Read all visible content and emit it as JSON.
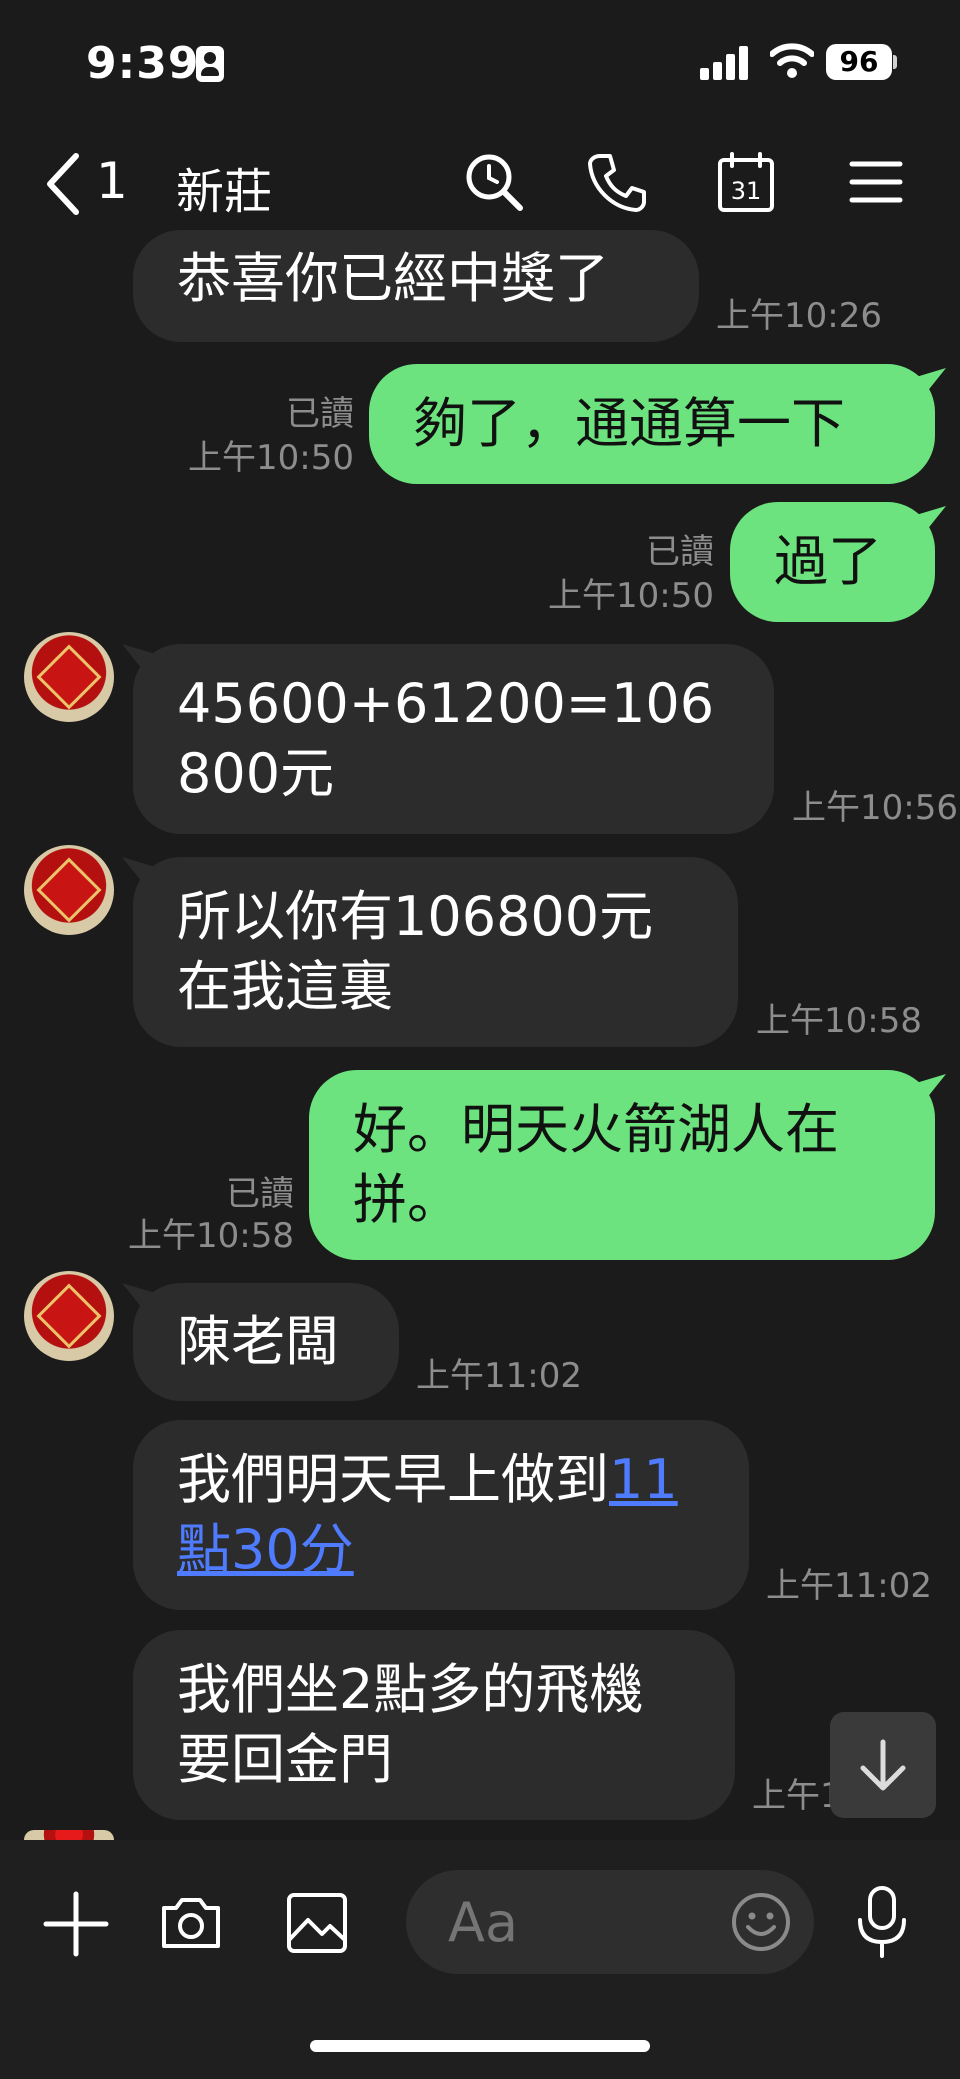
{
  "status_bar": {
    "time": "9:39",
    "battery": "96"
  },
  "header": {
    "back_count": "1",
    "title": "新莊"
  },
  "messages": [
    {
      "text": "恭喜你已經中獎了",
      "time": "上午10:26"
    },
    {
      "text": "夠了，通通算一下",
      "read": "已讀",
      "time": "上午10:50"
    },
    {
      "text": "過了",
      "read": "已讀",
      "time": "上午10:50"
    },
    {
      "text": "45600+61200=106\n800元",
      "time": "上午10:56"
    },
    {
      "text": "所以你有106800元\n在我這裏",
      "time": "上午10:58"
    },
    {
      "text": "好。明天火箭湖人在\n拼。",
      "read": "已讀",
      "time": "上午10:58"
    },
    {
      "text": "陳老闆",
      "time": "上午11:02"
    },
    {
      "text_before": "我們明天早上做到",
      "link": "11\n點30分",
      "time": "上午11:02"
    },
    {
      "text": "我們坐2點多的飛機\n要回金門",
      "time": "上午1"
    }
  ],
  "input": {
    "placeholder": "Aa"
  },
  "colors": {
    "background": "#1b1b1b",
    "incoming_bubble": "#2c2c2c",
    "outgoing_bubble": "#6ce37e",
    "link": "#4f7bff"
  }
}
